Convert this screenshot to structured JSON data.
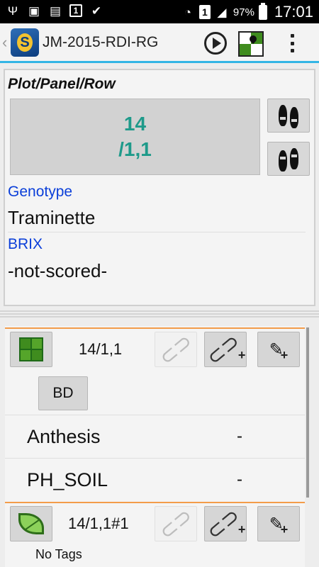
{
  "status": {
    "battery_percent": "97%",
    "time": "17:01",
    "sim": "1",
    "notif_box": "1"
  },
  "appbar": {
    "logo_letter": "S",
    "title": "JM-2015-RDI-RG"
  },
  "plot": {
    "label": "Plot/Panel/Row",
    "number_line1": "14",
    "number_line2": "/1,1",
    "fields": [
      {
        "label": "Genotype",
        "value": "Traminette"
      },
      {
        "label": "BRIX",
        "value": "-not-scored-"
      }
    ]
  },
  "list": {
    "rows": [
      {
        "code": "14/1,1"
      },
      {
        "code": "14/1,1#1"
      }
    ],
    "bd_label": "BD",
    "traits": [
      {
        "name": "Anthesis",
        "value": "-"
      },
      {
        "name": "PH_SOIL",
        "value": "-"
      }
    ],
    "no_tags": "No Tags"
  },
  "colors": {
    "accent_blue": "#33b5e5",
    "plot_number": "#1e9a8a",
    "field_label": "#0b3fd9",
    "orange_divider": "#f39c4a"
  }
}
